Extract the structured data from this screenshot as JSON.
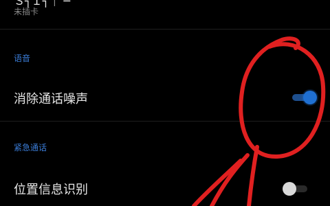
{
  "top_item": {
    "title": "Ｓ┐Ｉ┐｜ ─",
    "subtitle": "未插卡"
  },
  "section_voice": {
    "title": "语音"
  },
  "noise_cancel": {
    "label": "消除通话噪声",
    "enabled": true
  },
  "section_emergency": {
    "title": "紧急通话"
  },
  "location_id": {
    "label": "位置信息识别",
    "enabled": false
  },
  "colors": {
    "background": "#000000",
    "section_title": "#3a7bd5",
    "toggle_on": "#1f6fd1",
    "toggle_off_knob": "#d9d9d9",
    "annotation": "#e02020"
  }
}
